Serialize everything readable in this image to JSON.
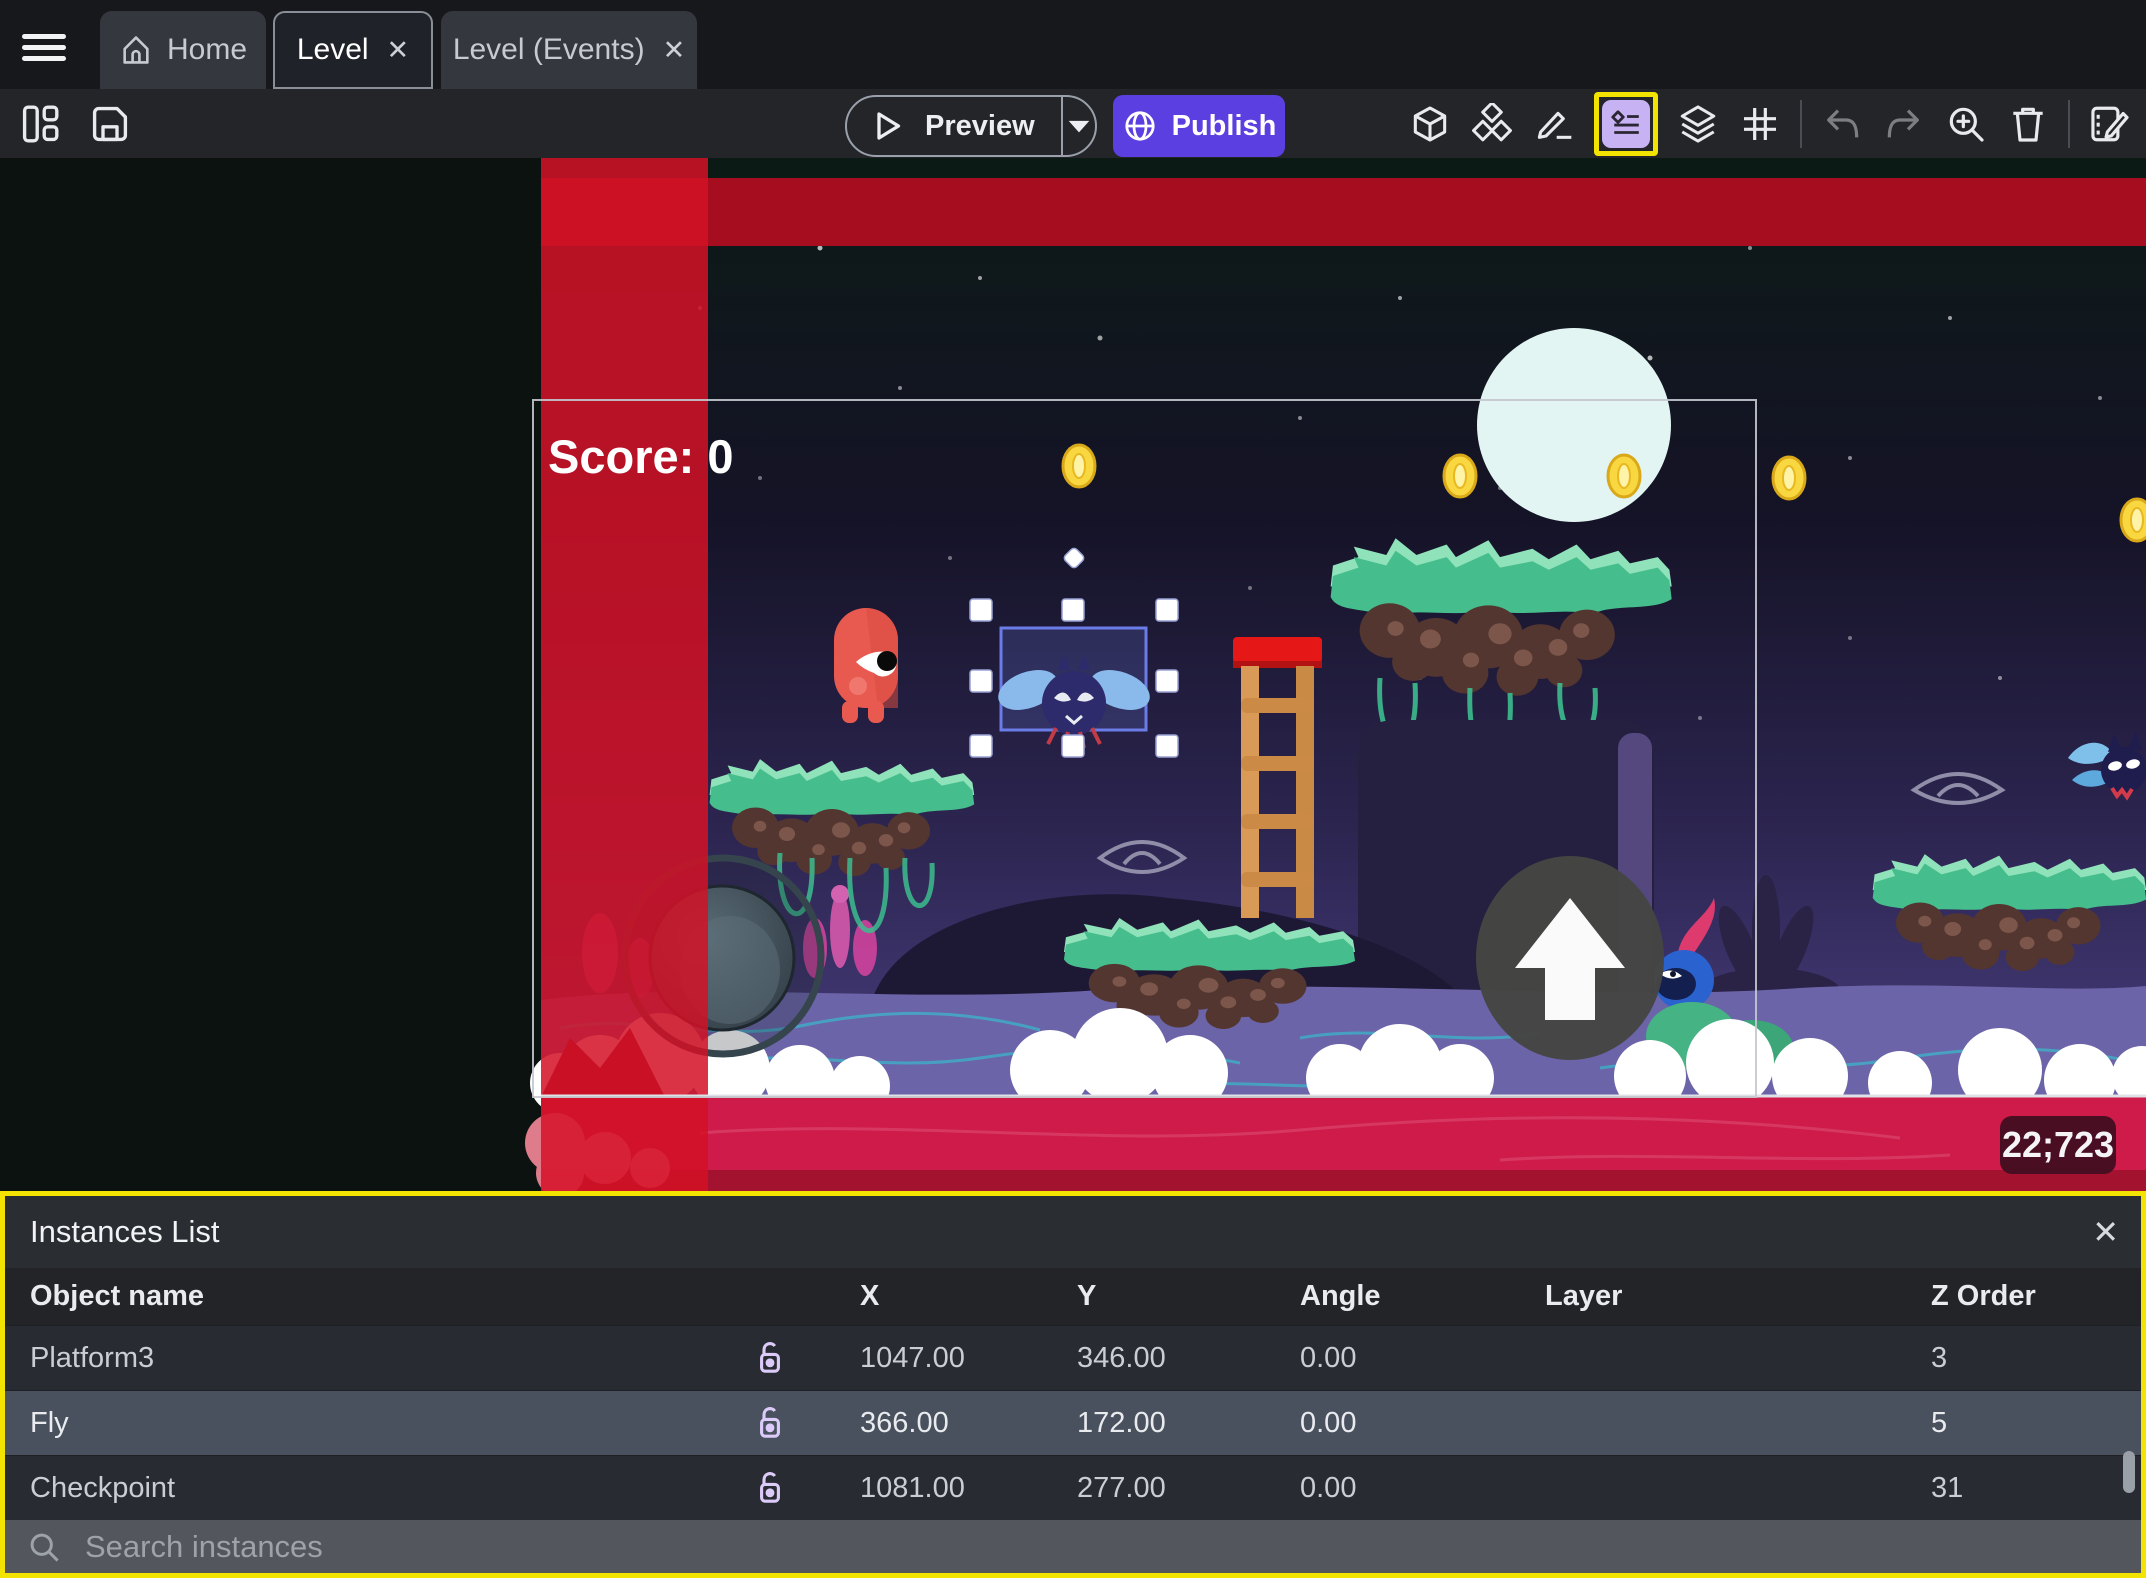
{
  "tabs": {
    "home": "Home",
    "level": "Level",
    "level_events": "Level (Events)",
    "close_glyph": "✕"
  },
  "toolbar": {
    "preview_label": "Preview",
    "publish_label": "Publish",
    "right_icons": [
      "cube-3d",
      "objects-stack",
      "edit-pencil",
      "instances-list",
      "layers",
      "grid",
      "undo",
      "redo",
      "zoom-in",
      "trash",
      "edit-scene"
    ]
  },
  "canvas": {
    "score_text": "Score: 0",
    "coords_badge": "22;723"
  },
  "panel": {
    "title": "Instances List",
    "close_glyph": "✕",
    "columns": {
      "name": "Object name",
      "x": "X",
      "y": "Y",
      "angle": "Angle",
      "layer": "Layer",
      "z": "Z Order"
    },
    "rows": [
      {
        "name": "Platform3",
        "x": "1047.00",
        "y": "346.00",
        "angle": "0.00",
        "layer": "",
        "z": "3"
      },
      {
        "name": "Fly",
        "x": "366.00",
        "y": "172.00",
        "angle": "0.00",
        "layer": "",
        "z": "5"
      },
      {
        "name": "Checkpoint",
        "x": "1081.00",
        "y": "277.00",
        "angle": "0.00",
        "layer": "",
        "z": "31"
      }
    ],
    "search_placeholder": "Search instances"
  },
  "colors": {
    "accent_purple": "#5b3fe0",
    "highlight_yellow": "#f2e400",
    "selection_blue": "#6b7ce8",
    "stripe_red": "#d31126",
    "band_red": "#ce1b4a",
    "lock_lavender": "#dccbf8"
  }
}
